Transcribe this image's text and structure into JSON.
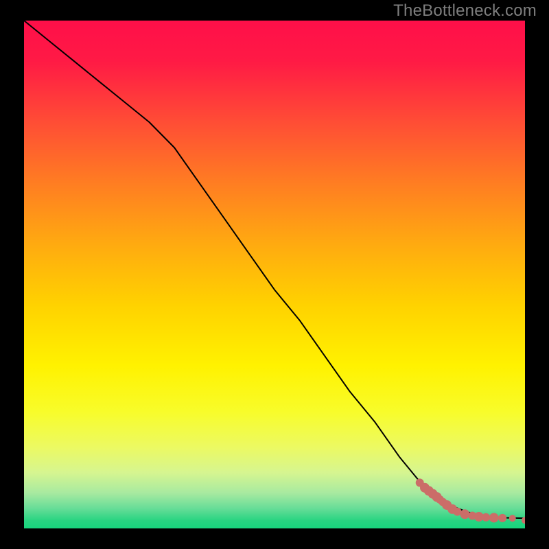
{
  "attribution": "TheBottleneck.com",
  "colors": {
    "line": "#000000",
    "markers": "#cb6d68",
    "backgroundTop": "#ff0f49",
    "backgroundMid": "#fff700",
    "backgroundBottom": "#18d47d",
    "frame": "#000000"
  },
  "chart_data": {
    "type": "line",
    "title": "",
    "subtitle": "",
    "xlabel": "",
    "ylabel": "",
    "xlim": [
      0,
      100
    ],
    "ylim": [
      0,
      100
    ],
    "legend": false,
    "grid": false,
    "background": "rainbow-vertical-gradient",
    "series": [
      {
        "name": "curve",
        "type": "line",
        "color": "#000000",
        "width": 2,
        "x": [
          0,
          5,
          10,
          15,
          20,
          25,
          30,
          35,
          40,
          45,
          50,
          55,
          60,
          65,
          70,
          75,
          80,
          82,
          84,
          86,
          88,
          90,
          92,
          94,
          96,
          98,
          100
        ],
        "y": [
          100,
          96,
          92,
          88,
          84,
          80,
          75,
          68,
          61,
          54,
          47,
          41,
          34,
          27,
          21,
          14,
          8,
          6.5,
          5.2,
          4.2,
          3.4,
          2.8,
          2.4,
          2.2,
          2.1,
          2.05,
          2.0
        ]
      },
      {
        "name": "markers",
        "type": "scatter",
        "color": "#cb6d68",
        "radius_default": 7,
        "points": [
          {
            "x": 79.0,
            "y": 9.0,
            "r": 6
          },
          {
            "x": 80.0,
            "y": 8.0,
            "r": 7
          },
          {
            "x": 80.8,
            "y": 7.4,
            "r": 7
          },
          {
            "x": 81.6,
            "y": 6.8,
            "r": 7
          },
          {
            "x": 82.4,
            "y": 6.2,
            "r": 7
          },
          {
            "x": 83.0,
            "y": 5.7,
            "r": 6
          },
          {
            "x": 83.6,
            "y": 5.2,
            "r": 6
          },
          {
            "x": 84.4,
            "y": 4.6,
            "r": 7
          },
          {
            "x": 85.5,
            "y": 3.8,
            "r": 7
          },
          {
            "x": 86.5,
            "y": 3.3,
            "r": 6
          },
          {
            "x": 88.0,
            "y": 2.8,
            "r": 7
          },
          {
            "x": 89.5,
            "y": 2.5,
            "r": 6
          },
          {
            "x": 90.8,
            "y": 2.3,
            "r": 7
          },
          {
            "x": 92.2,
            "y": 2.2,
            "r": 6
          },
          {
            "x": 93.8,
            "y": 2.1,
            "r": 7
          },
          {
            "x": 95.5,
            "y": 2.05,
            "r": 6
          },
          {
            "x": 97.5,
            "y": 2.0,
            "r": 5
          },
          {
            "x": 100.0,
            "y": 1.6,
            "r": 5
          }
        ]
      }
    ],
    "gradient_stops": [
      {
        "offset": 0.0,
        "color": "#ff0f49"
      },
      {
        "offset": 0.08,
        "color": "#ff1a45"
      },
      {
        "offset": 0.2,
        "color": "#ff4d35"
      },
      {
        "offset": 0.32,
        "color": "#ff7d22"
      },
      {
        "offset": 0.44,
        "color": "#ffaa10"
      },
      {
        "offset": 0.56,
        "color": "#ffd200"
      },
      {
        "offset": 0.68,
        "color": "#fff200"
      },
      {
        "offset": 0.77,
        "color": "#f8fc2a"
      },
      {
        "offset": 0.84,
        "color": "#ecfa62"
      },
      {
        "offset": 0.89,
        "color": "#d6f590"
      },
      {
        "offset": 0.93,
        "color": "#a8eaa0"
      },
      {
        "offset": 0.96,
        "color": "#68dd98"
      },
      {
        "offset": 0.985,
        "color": "#27d481"
      },
      {
        "offset": 1.0,
        "color": "#18d47d"
      }
    ]
  }
}
